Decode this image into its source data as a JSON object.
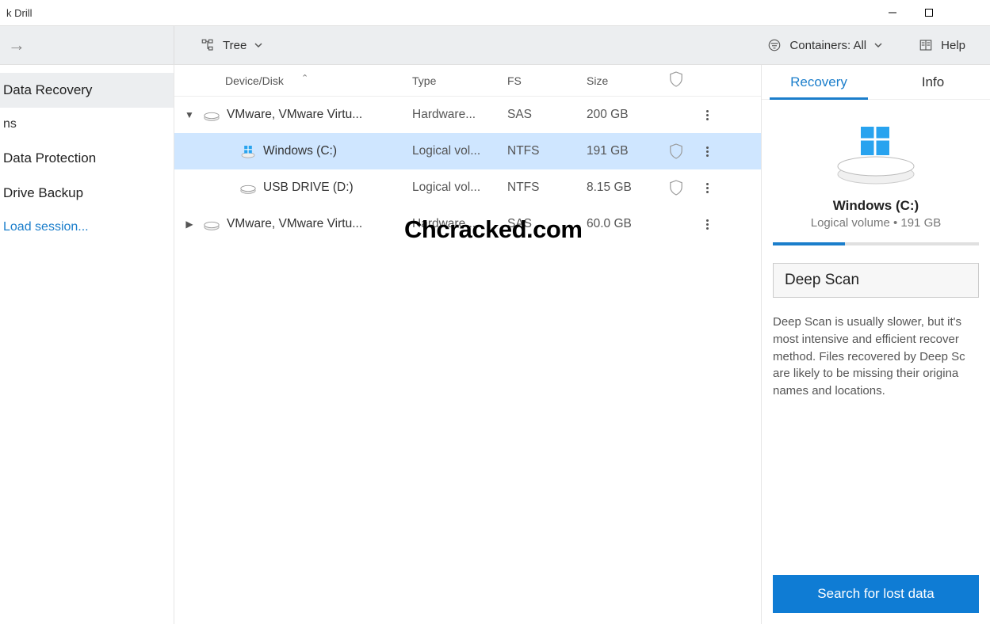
{
  "window": {
    "title": "k Drill"
  },
  "toolbar": {
    "view_mode": "Tree",
    "containers_label": "Containers: All",
    "help": "Help"
  },
  "sidebar": {
    "items": [
      {
        "label": "Data Recovery",
        "selected": true
      },
      {
        "label": "ns"
      },
      {
        "label": "Data Protection"
      },
      {
        "label": "Drive Backup"
      }
    ],
    "link": "Load session..."
  },
  "columns": {
    "device": "Device/Disk",
    "type": "Type",
    "fs": "FS",
    "size": "Size"
  },
  "rows": [
    {
      "level": 0,
      "expander": "down",
      "name": "VMware, VMware Virtu...",
      "type": "Hardware...",
      "fs": "SAS",
      "size": "200 GB",
      "shield": false,
      "menu": true,
      "icon": "hdd"
    },
    {
      "level": 1,
      "expander": "none",
      "name": "Windows (C:)",
      "type": "Logical vol...",
      "fs": "NTFS",
      "size": "191 GB",
      "shield": true,
      "menu": true,
      "selected": true,
      "icon": "win"
    },
    {
      "level": 1,
      "expander": "none",
      "name": "USB DRIVE (D:)",
      "type": "Logical vol...",
      "fs": "NTFS",
      "size": "8.15 GB",
      "shield": true,
      "menu": true,
      "icon": "hdd"
    },
    {
      "level": 0,
      "expander": "right",
      "name": "VMware, VMware Virtu...",
      "type": "Hardware...",
      "fs": "SAS",
      "size": "60.0 GB",
      "shield": false,
      "menu": true,
      "icon": "hdd"
    }
  ],
  "watermark": "Chcracked.com",
  "right_panel": {
    "tabs": {
      "recovery": "Recovery",
      "info": "Info"
    },
    "title": "Windows (C:)",
    "subtitle": "Logical volume • 191 GB",
    "scan_type": "Deep Scan",
    "description": "Deep Scan is usually slower, but it's most intensive and efficient recover method. Files recovered by Deep Sc are likely to be missing their origina names and locations.",
    "cta": "Search for lost data"
  }
}
